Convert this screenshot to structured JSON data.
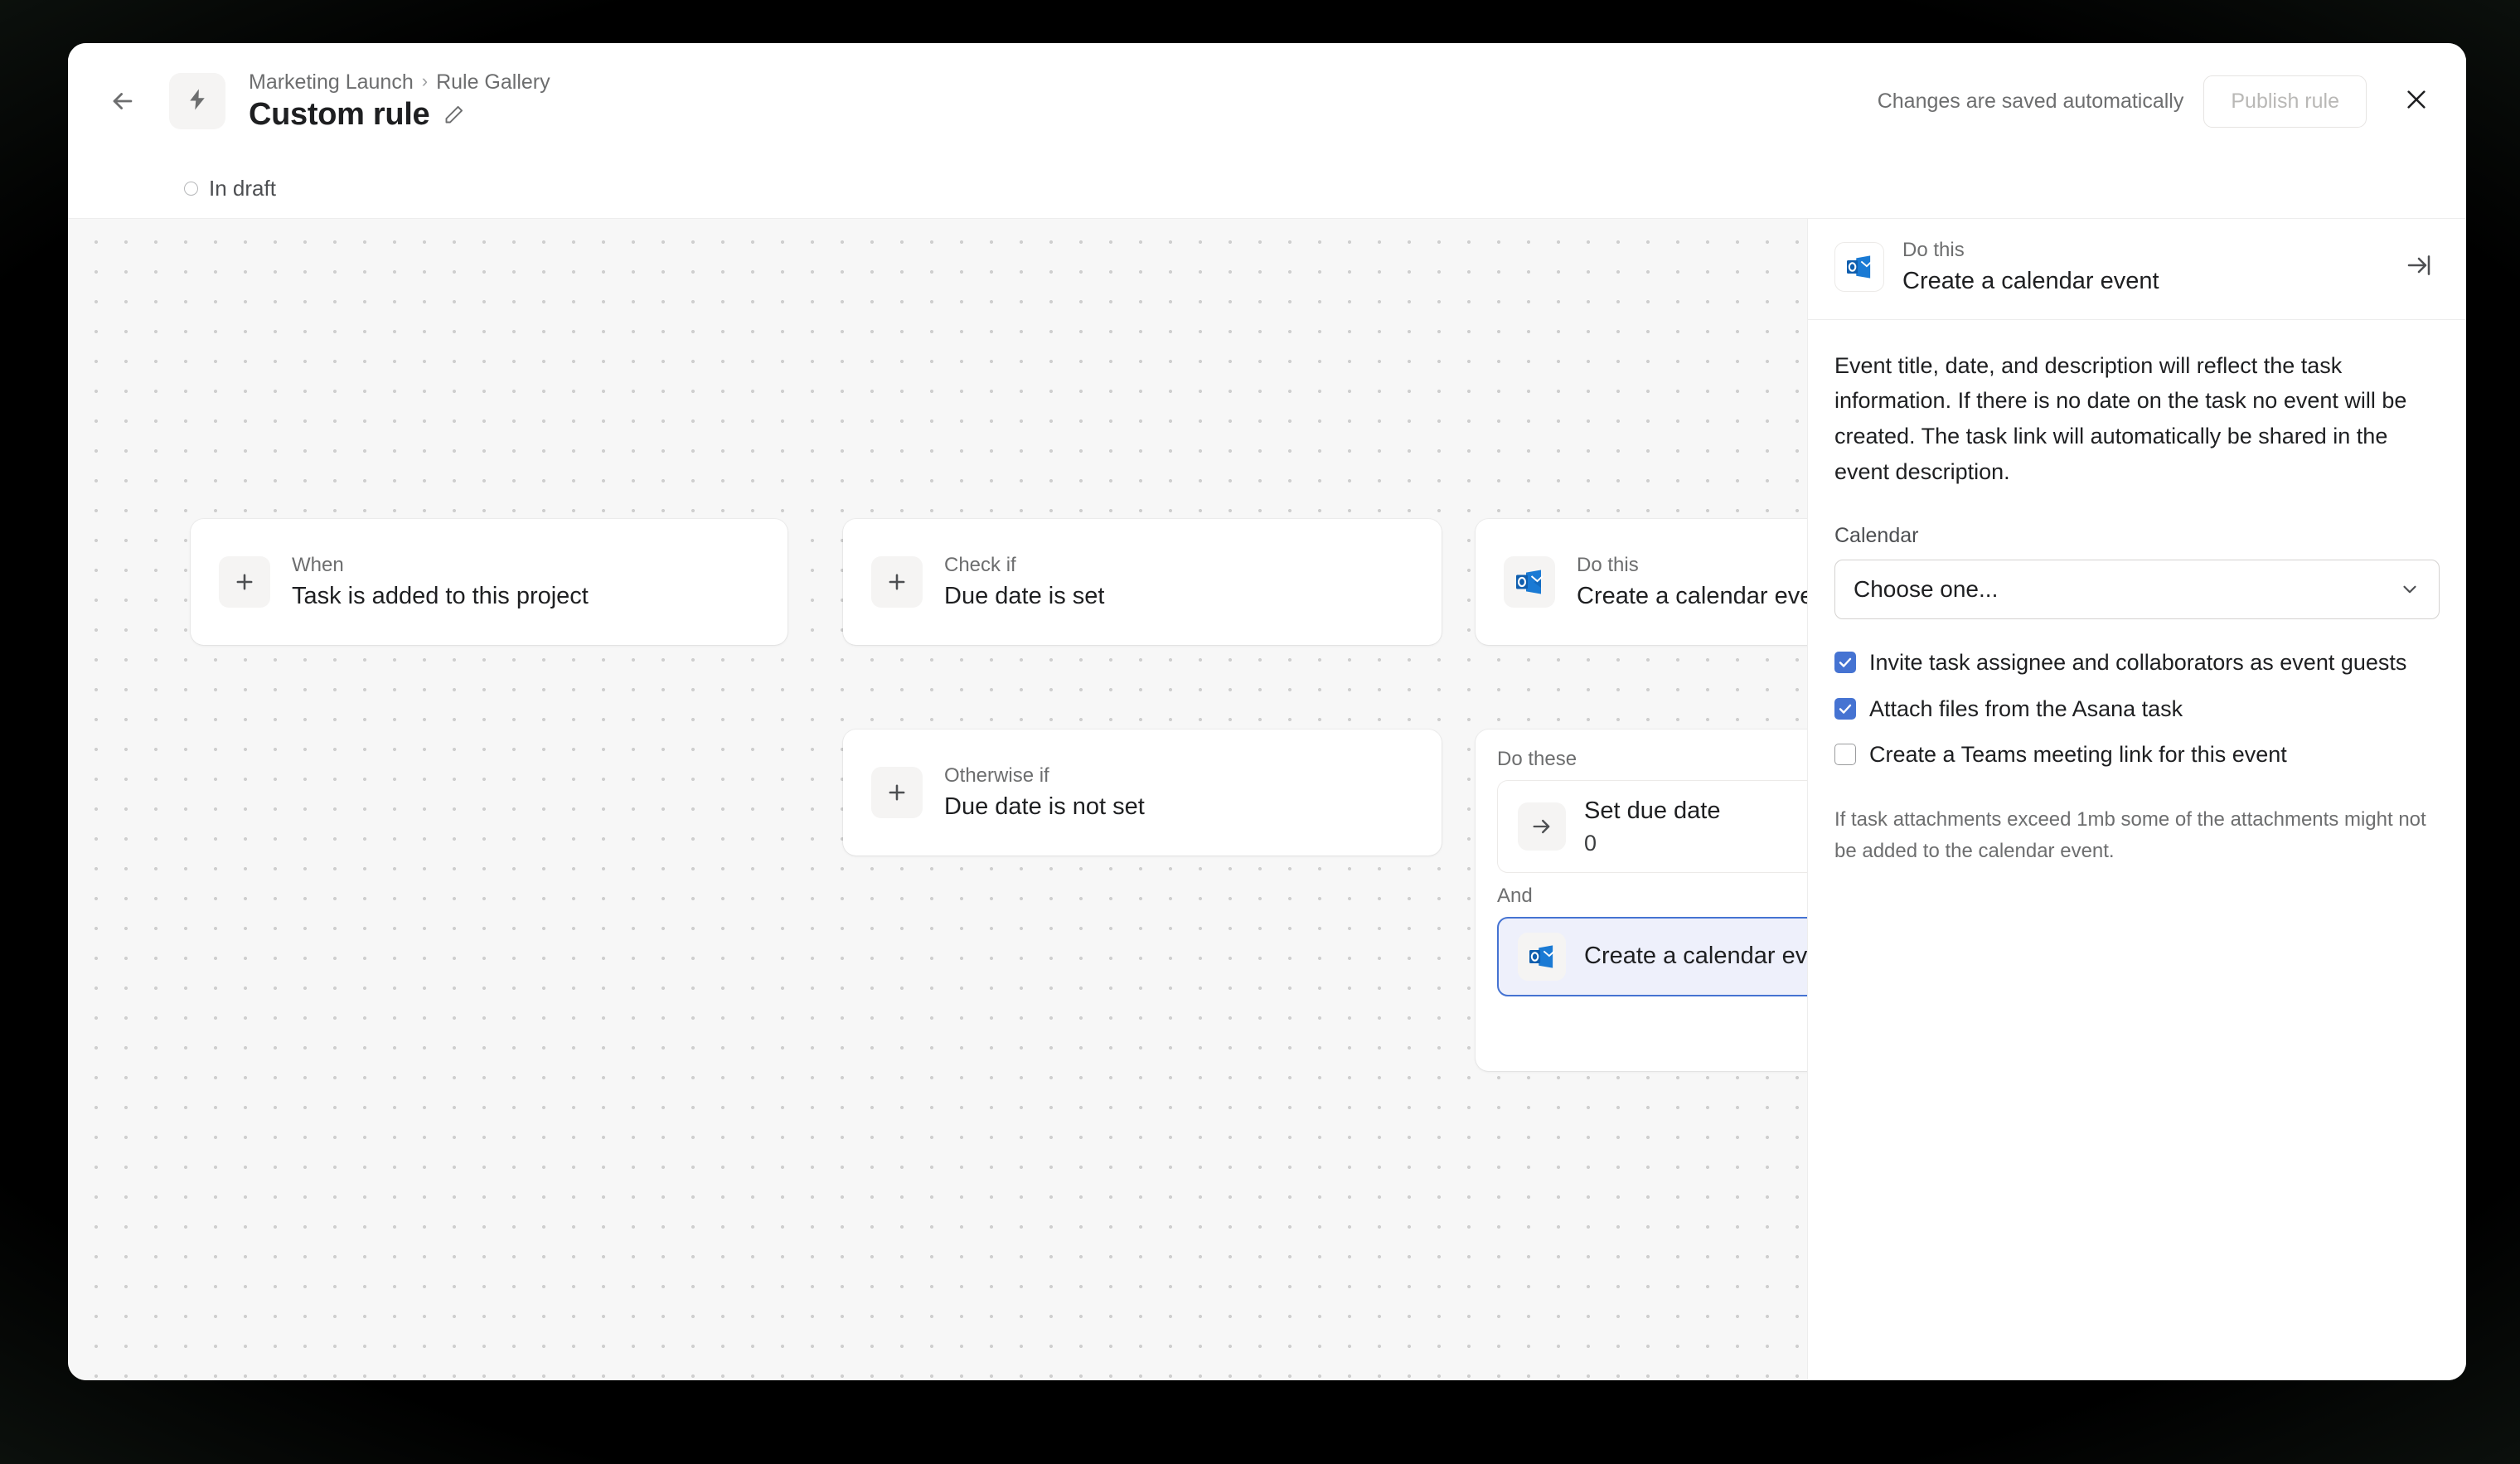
{
  "header": {
    "back_icon": "arrow-left-icon",
    "bolt_icon": "lightning-bolt-icon",
    "breadcrumb": {
      "project": "Marketing Launch",
      "separator": "›",
      "section": "Rule Gallery"
    },
    "title": "Custom rule",
    "edit_icon": "pencil-icon",
    "saved_note": "Changes are saved automatically",
    "publish_label": "Publish rule",
    "publish_disabled": true,
    "close_icon": "close-icon"
  },
  "status": {
    "label": "In draft",
    "icon": "circle-outline-icon"
  },
  "canvas": {
    "nodes": [
      {
        "kicker": "When",
        "label": "Task is added to this project",
        "icon": "plus-icon"
      },
      {
        "kicker": "Check if",
        "label": "Due date is set",
        "icon": "plus-icon"
      },
      {
        "kicker": "Otherwise if",
        "label": "Due date is not set",
        "icon": "plus-icon"
      },
      {
        "kicker": "Do this",
        "label": "Create a calendar event",
        "icon": "outlook-icon"
      }
    ],
    "group": {
      "kicker": "Do these",
      "and_label": "And",
      "actions": [
        {
          "title": "Set due date",
          "value": "0",
          "icon": "arrow-right-icon",
          "selected": false
        },
        {
          "title": "Create a calendar event",
          "icon": "outlook-icon",
          "selected": true
        }
      ]
    }
  },
  "panel": {
    "kicker": "Do this",
    "title": "Create a calendar event",
    "icon": "outlook-icon",
    "collapse_icon": "collapse-right-icon",
    "description": "Event title, date, and description will reflect the task information. If there is no date on the task no event will be created. The task link will automatically be shared in the event description.",
    "calendar_label": "Calendar",
    "calendar_value": "Choose one...",
    "caret_icon": "chevron-down-icon",
    "checkboxes": [
      {
        "label": "Invite task assignee and collaborators as event guests",
        "checked": true
      },
      {
        "label": "Attach files from the Asana task",
        "checked": true
      },
      {
        "label": "Create a Teams meeting link for this event",
        "checked": false
      }
    ],
    "note": "If task attachments exceed 1mb some of the attachments might not be added to the calendar event."
  },
  "colors": {
    "accent": "#4573d2",
    "selected_bg": "#eef0fb",
    "outlook_blue": "#0f6cbd",
    "canvas_bg": "#f7f7f7",
    "text": "#1e1f21",
    "muted": "#6d6e6f"
  }
}
